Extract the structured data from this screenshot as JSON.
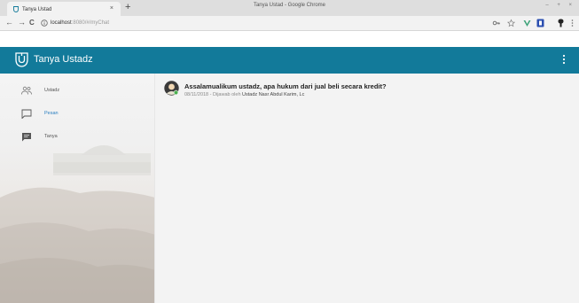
{
  "browser": {
    "window_title": "Tanya Ustad - Google Chrome",
    "window_controls": "– + ×",
    "tab_title": "Tanya Ustad",
    "tab_close": "×",
    "new_tab": "+",
    "back": "←",
    "forward": "→",
    "reload": "C",
    "url_host": "localhost",
    "url_path": ":8080/#/myChat"
  },
  "app": {
    "title": "Tanya Ustadz",
    "bar_color": "#127a9a",
    "logo_icon": "shield-logo-icon",
    "menu_icon": "more-vert-icon"
  },
  "sidebar": {
    "items": [
      {
        "label": "Ustadz",
        "icon": "group-icon",
        "active": false
      },
      {
        "label": "Pesan",
        "icon": "chat-bubble-outline-icon",
        "active": true
      },
      {
        "label": "Tanya",
        "icon": "chat-bubble-icon",
        "active": false
      }
    ]
  },
  "question": {
    "title": "Assalamualikum ustadz, apa hukum dari jual beli secara kredit?",
    "date": "08/11/2018",
    "answered_by_label": "Dijawab oleh",
    "answerer": "Ustadz Nasr Abdul Karim, Lc",
    "avatar_icon": "user-avatar-icon"
  },
  "colors": {
    "accent": "#127a9a",
    "active_link": "#2a7fc0"
  }
}
